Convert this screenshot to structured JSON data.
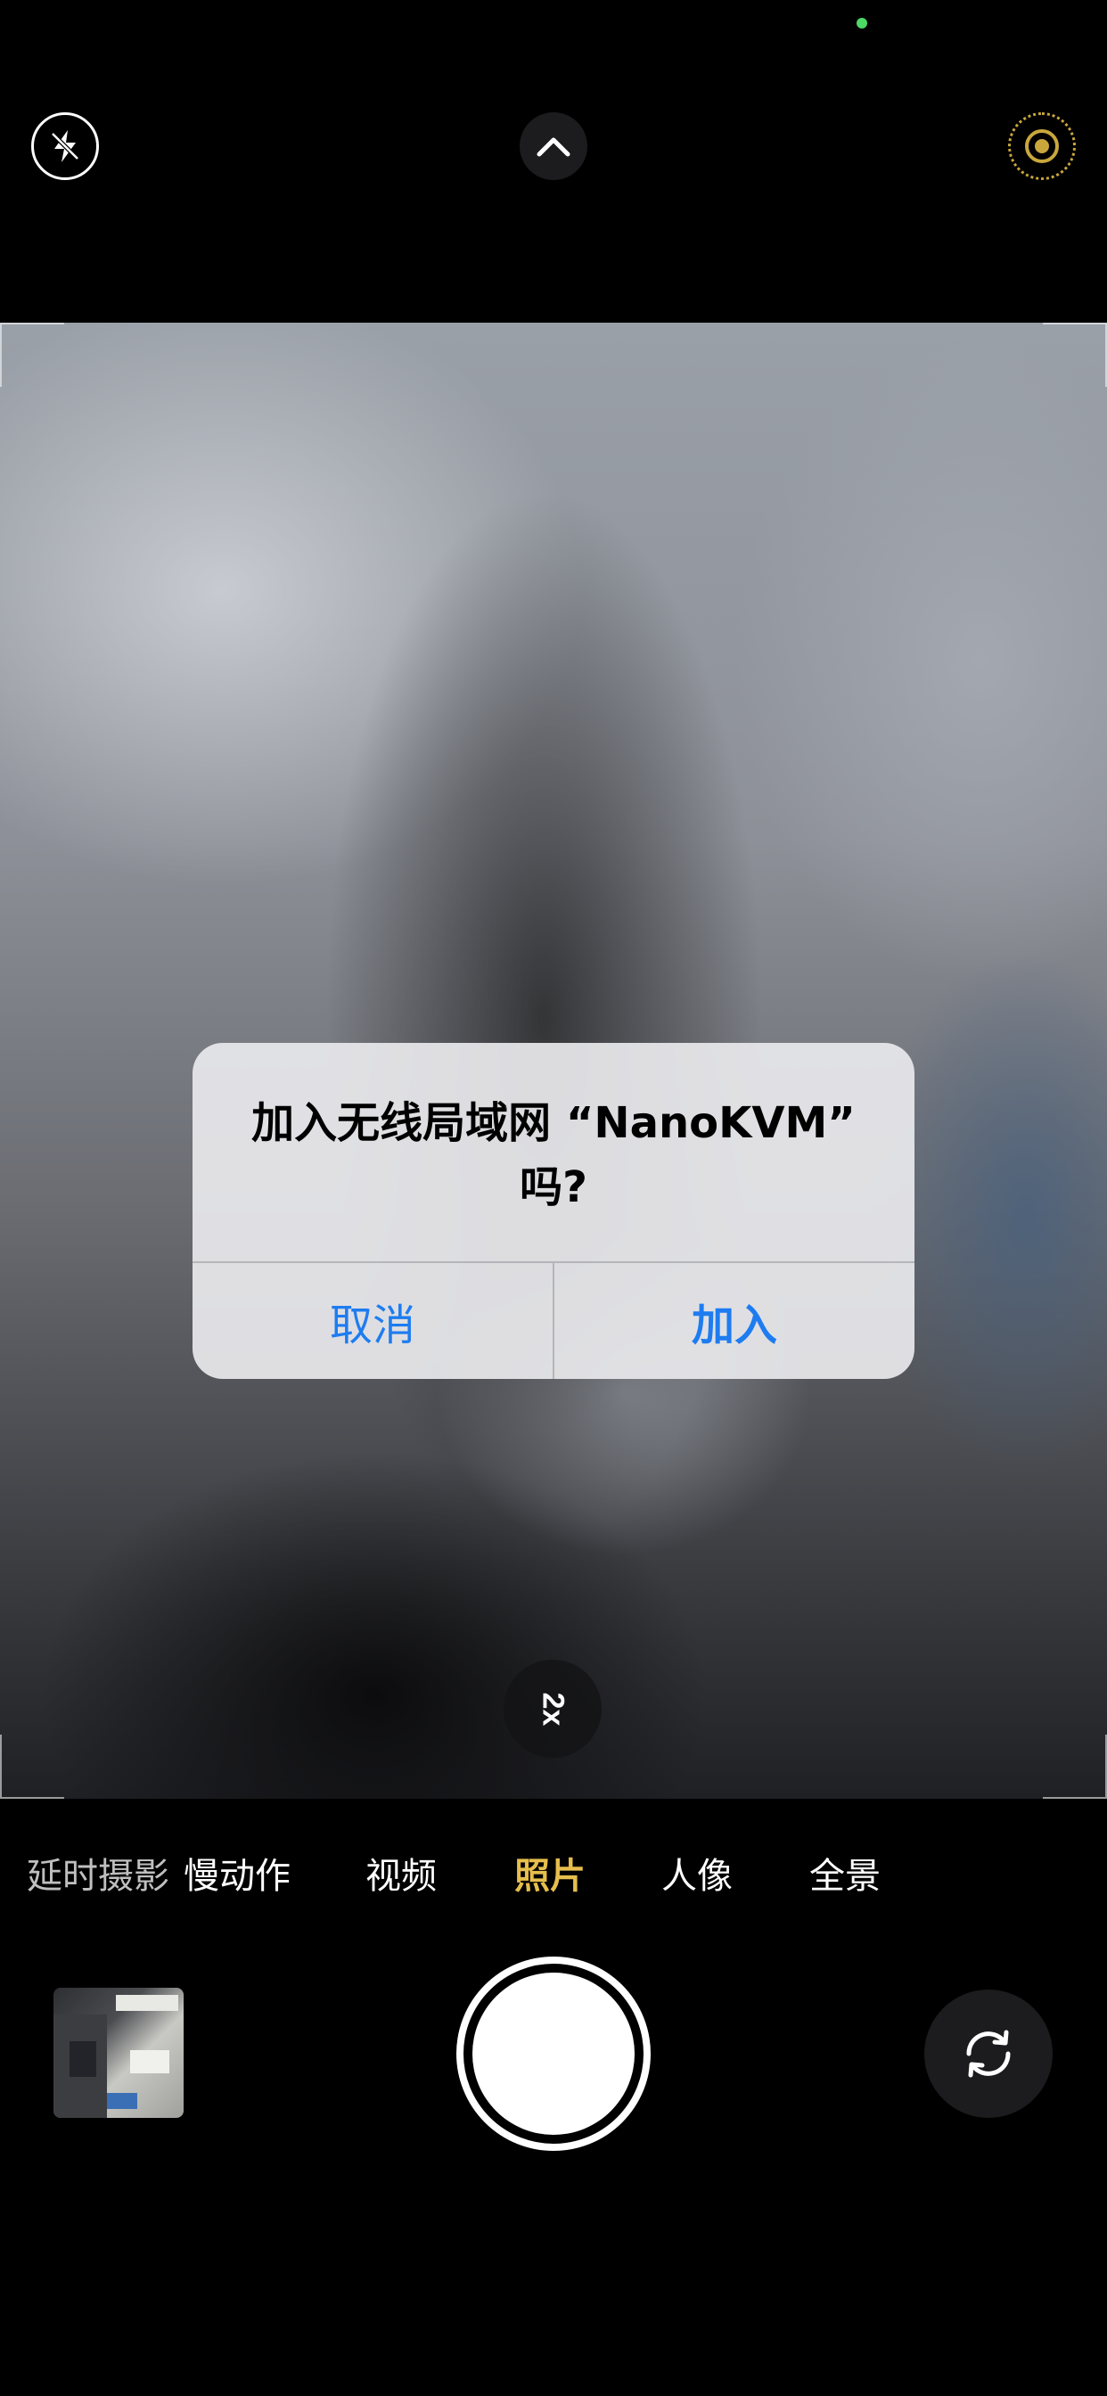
{
  "top_bar": {
    "flash_icon": "flash-auto-icon",
    "chevron_icon": "chevron-up-icon",
    "live_icon": "live-photo-icon",
    "accent_color": "#c9a73c"
  },
  "viewfinder": {
    "zoom_label": "2x"
  },
  "alert": {
    "title": "加入无线局域网 “NanoKVM” 吗?",
    "cancel_label": "取消",
    "join_label": "加入",
    "button_color": "#1e7cf0"
  },
  "modes": {
    "items": [
      "延时摄影",
      "慢动作",
      "视频",
      "照片",
      "人像",
      "全景"
    ],
    "active": "照片",
    "active_color": "#e6be4d"
  },
  "controls": {
    "thumbnail_icon": "last-photo-thumbnail",
    "shutter_icon": "shutter-button",
    "flip_icon": "camera-flip-icon"
  }
}
